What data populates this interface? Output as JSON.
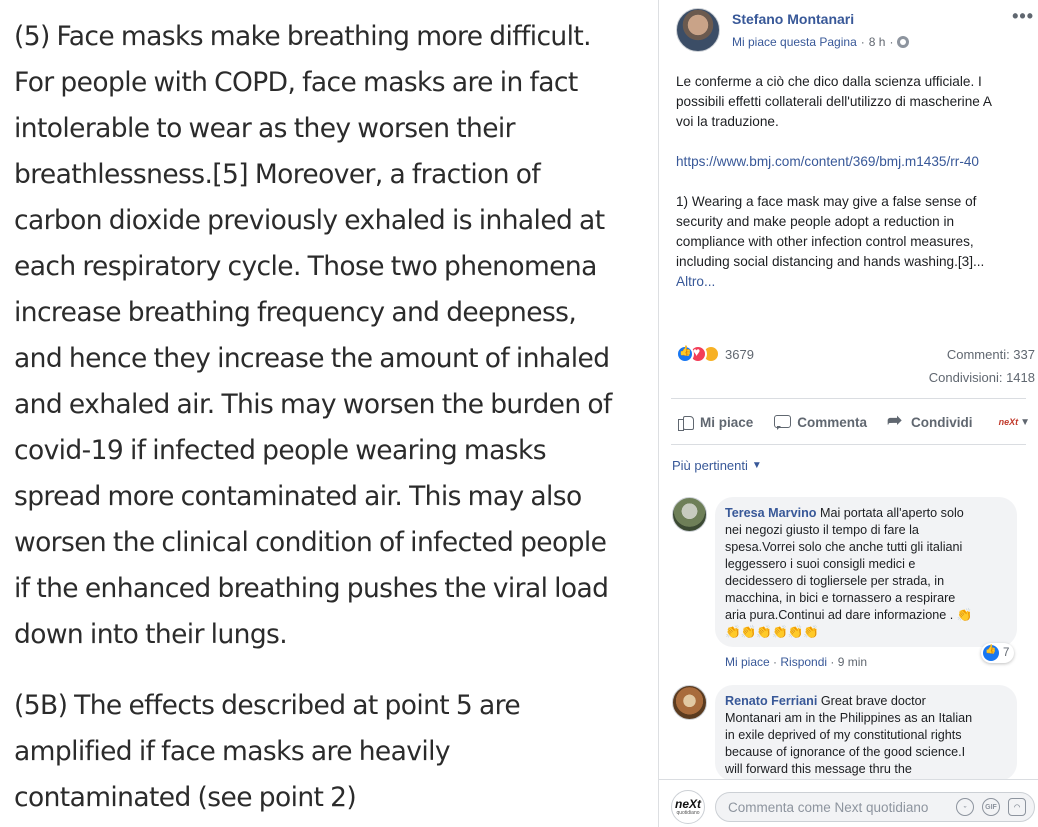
{
  "article": {
    "para1": [
      "(5) Face masks make breathing more difficult.",
      "For people with COPD, face masks are in fact",
      "intolerable to wear as they worsen their",
      "breathlessness.[5] Moreover, a fraction of",
      "carbon dioxide previously exhaled is inhaled at",
      "each respiratory cycle. Those two phenomena",
      "increase breathing frequency and deepness,",
      "and hence they increase the amount of inhaled",
      "and exhaled air. This may worsen the burden of",
      "covid-19 if infected people wearing masks",
      "spread more contaminated air. This may also",
      "worsen the clinical condition of infected people",
      "if the enhanced breathing pushes the viral load",
      "down into their lungs."
    ],
    "para2": [
      "(5B) The effects described at point 5 are",
      "amplified if face masks are heavily",
      "contaminated (see point 2)"
    ]
  },
  "post": {
    "author": "Stefano Montanari",
    "like_page": "Mi piace questa Pagina",
    "separator": "·",
    "time": "8 h",
    "separator2": "·",
    "more_icon": "more-dots-icon",
    "more_glyph": "•••",
    "text_lines": [
      "Le conferme a ciò che dico dalla scienza ufficiale. I",
      "possibili effetti collaterali dell'utilizzo di mascherine A",
      "voi la traduzione."
    ],
    "url": "https://www.bmj.com/content/369/bmj.m1435/rr-40",
    "quote_lines": [
      "1) Wearing a face mask may give a false sense of",
      "security and make people adopt a reduction in",
      "compliance with other infection control measures,",
      "including social distancing and hands washing.[3]..."
    ],
    "more_link": "Altro...",
    "reactions_count": "3679",
    "comments_stat": "Commenti: 337",
    "shares_stat": "Condivisioni: 1418",
    "actions": {
      "like": "Mi piace",
      "comment": "Commenta",
      "share": "Condividi"
    },
    "page_switch_logo": "neXt",
    "relevance": "Più pertinenti",
    "comments": [
      {
        "name": "Teresa Marvino",
        "first_line": "Mai portata all'aperto solo",
        "lines": [
          "nei negozi giusto il tempo di fare la",
          "spesa.Vorrei solo che anche tutti gli italiani",
          "leggessero i suoi consigli medici e",
          "decidessero di togliersele per strada, in",
          "macchina, in bici e tornassero a respirare",
          "aria pura.Continui ad dare informazione ."
        ],
        "claps_end": "👏",
        "claps_line": "👏👏👏👏👏👏",
        "like": "Mi piace",
        "dot": "·",
        "reply": "Rispondi",
        "dot2": "·",
        "time": "9 min",
        "likes": "7"
      },
      {
        "name": "Renato Ferriani",
        "first_line": "Great brave doctor",
        "lines": [
          "Montanari am in the Philippines as an Italian",
          "in exile deprived of my constitutional rights",
          "because of ignorance of the good science.I",
          "will forward this message thru the"
        ]
      }
    ],
    "composer": {
      "logo_text": "neXt",
      "logo_sub": "quotidiano",
      "placeholder": "Commenta come Next quotidiano",
      "gif_label": "GIF"
    }
  },
  "colors": {
    "link": "#385898",
    "muted": "#606770",
    "bubble": "#f2f3f5",
    "like_blue": "#1877f2",
    "love_red": "#f33e58"
  }
}
